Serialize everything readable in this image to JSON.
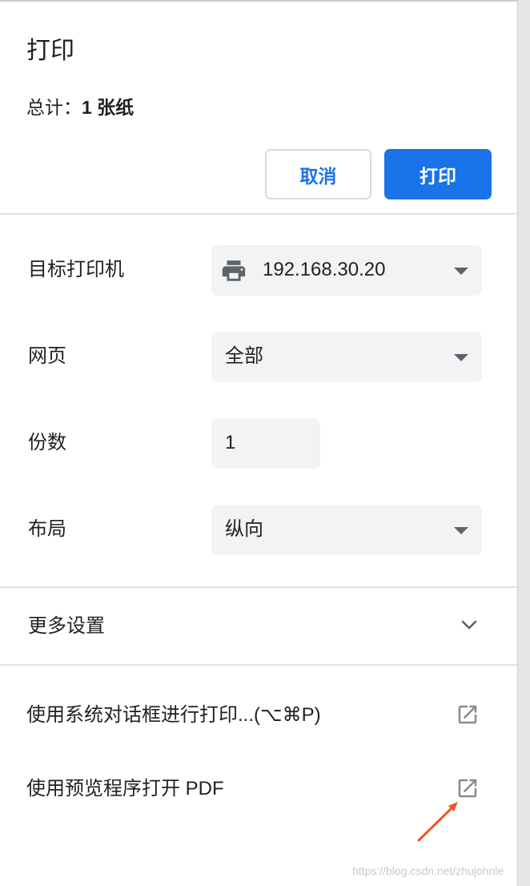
{
  "header": {
    "title": "打印",
    "summary_prefix": "总计：",
    "summary_count": "1 张纸"
  },
  "buttons": {
    "cancel_label": "取消",
    "print_label": "打印"
  },
  "settings": {
    "destination": {
      "label": "目标打印机",
      "value": "192.168.30.20",
      "icon": "printer-icon"
    },
    "pages": {
      "label": "网页",
      "value": "全部"
    },
    "copies": {
      "label": "份数",
      "value": "1"
    },
    "layout": {
      "label": "布局",
      "value": "纵向"
    }
  },
  "more_settings": {
    "label": "更多设置",
    "icon": "chevron-down-icon"
  },
  "links": [
    {
      "label": "使用系统对话框进行打印...(⌥⌘P)",
      "icon": "open-in-new-icon"
    },
    {
      "label": "使用预览程序打开 PDF",
      "icon": "open-in-new-icon"
    }
  ],
  "annotation": {
    "arrow_color": "#f2551f"
  },
  "watermark": "https://blog.csdn.net/zhujohnle",
  "colors": {
    "accent": "#1a73e8",
    "field_bg": "#f1f3f4",
    "icon_gray": "#5f6368"
  }
}
